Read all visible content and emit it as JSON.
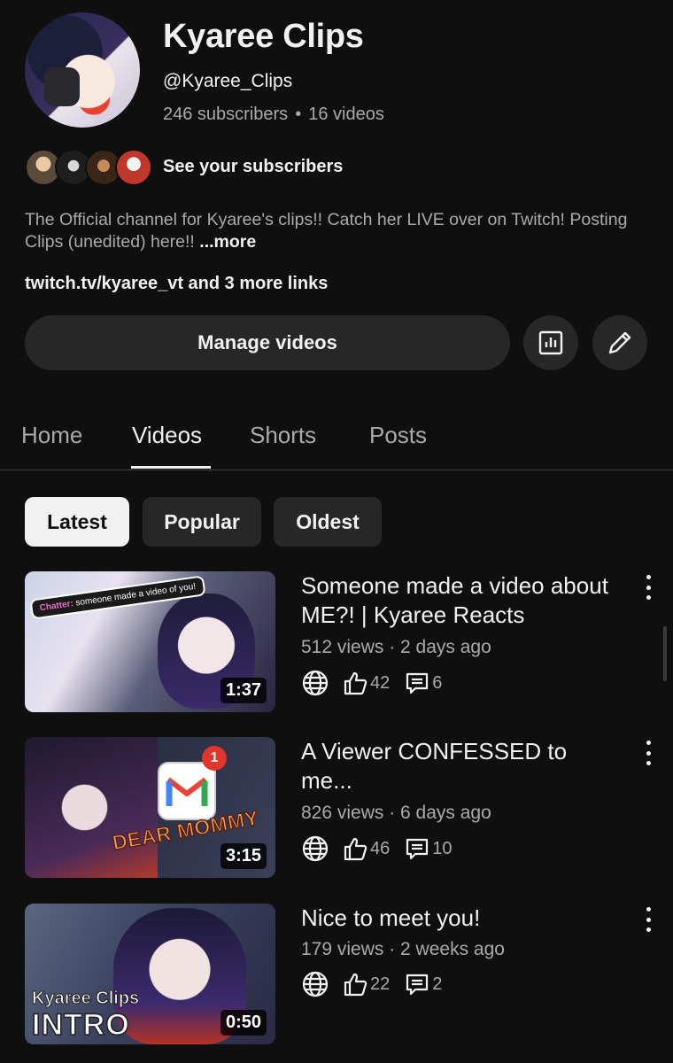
{
  "channel": {
    "name": "Kyaree Clips",
    "handle": "@Kyaree_Clips",
    "subscribers": "246 subscribers",
    "separator": "•",
    "videos": "16 videos",
    "see_subscribers": "See your subscribers",
    "description": "The Official channel for Kyaree's clips!! Catch her LIVE over on Twitch! Posting Clips (unedited) here!! ",
    "more_label": "...more",
    "links": "twitch.tv/kyaree_vt and 3 more links"
  },
  "actions": {
    "manage_videos": "Manage videos",
    "analytics_icon": "analytics-icon",
    "edit_icon": "pencil-icon"
  },
  "tabs": [
    {
      "label": "Home"
    },
    {
      "label": "Videos",
      "active": true
    },
    {
      "label": "Shorts"
    },
    {
      "label": "Posts"
    }
  ],
  "filters": [
    {
      "label": "Latest",
      "active": true
    },
    {
      "label": "Popular"
    },
    {
      "label": "Oldest"
    }
  ],
  "videos": [
    {
      "title": "Someone made a video about ME?! | Kyaree Reacts",
      "meta": "512 views · 2 days ago",
      "likes": "42",
      "comments": "6",
      "duration": "1:37",
      "thumb_text": {
        "chatter_label": "Chatter:",
        "chatter_msg": "someone made a video of you!"
      }
    },
    {
      "title": "A Viewer CONFESSED to me...",
      "meta": "826 views · 6 days ago",
      "likes": "46",
      "comments": "10",
      "duration": "3:15",
      "thumb_text": {
        "badge": "1",
        "overlay": "DEAR MOMMY",
        "mail_letter": "M"
      }
    },
    {
      "title": "Nice to meet you!",
      "meta": "179 views · 2 weeks ago",
      "likes": "22",
      "comments": "2",
      "duration": "0:50",
      "thumb_text": {
        "brand": "Kyaree Clips",
        "overlay": "INTRO"
      }
    }
  ],
  "colors": {
    "background": "#0f0f0f",
    "surface": "#272727",
    "text_primary": "#f1f1f1",
    "text_secondary": "#aaaaaa",
    "notification_red": "#e0362b"
  }
}
